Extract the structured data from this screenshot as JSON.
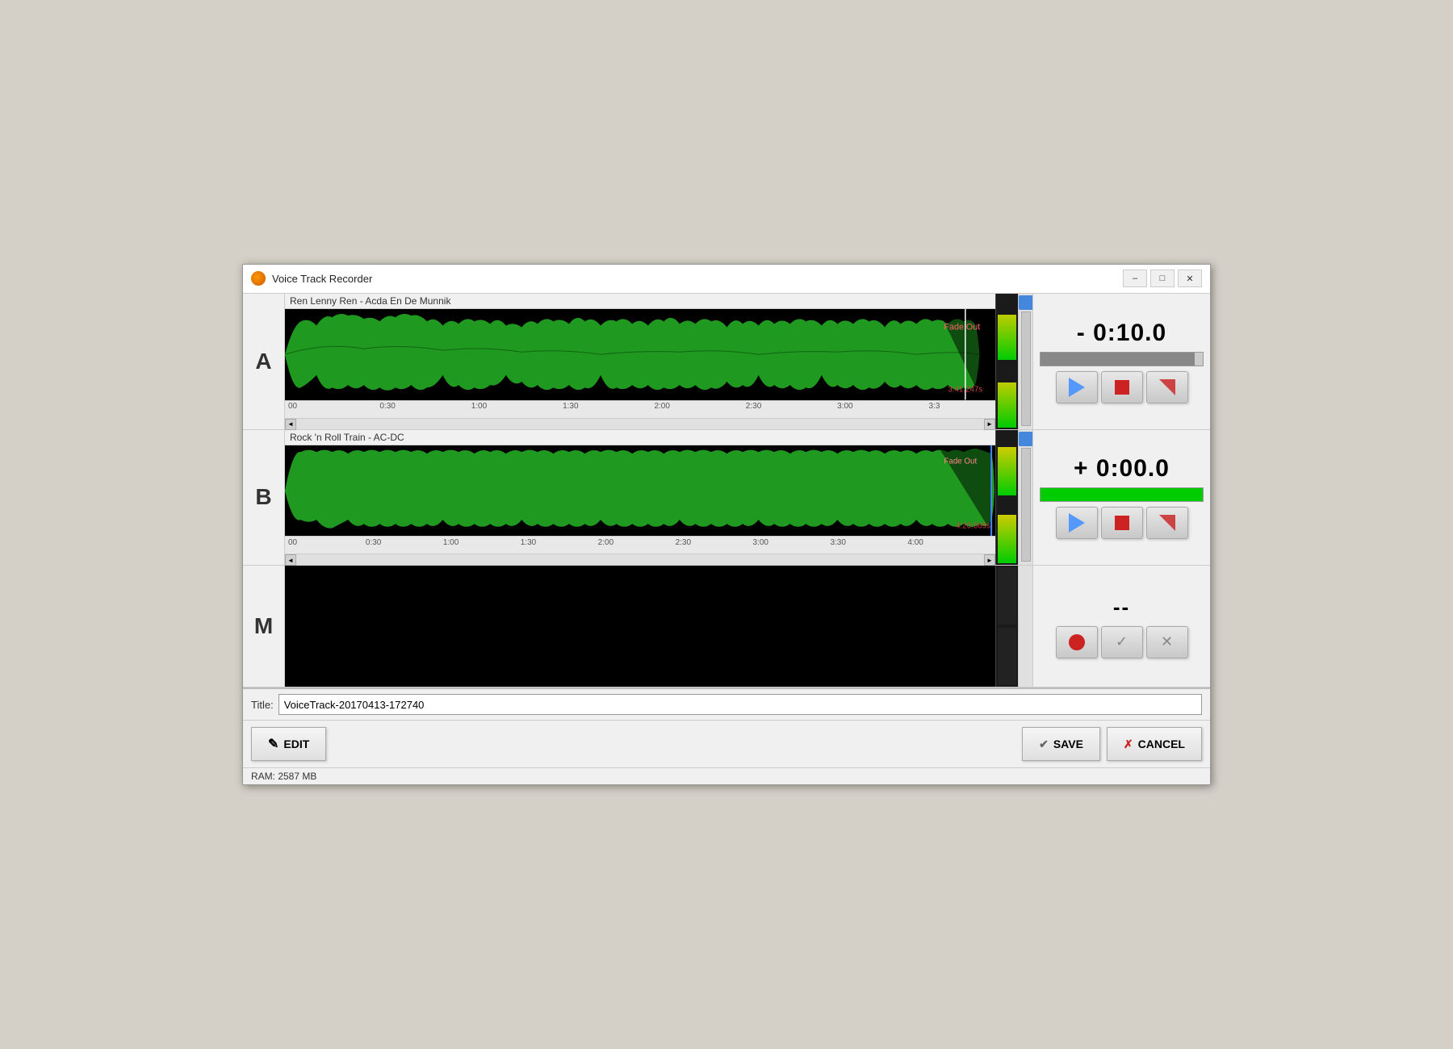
{
  "window": {
    "title": "Voice Track Recorder",
    "icon": "orange-circle"
  },
  "title_controls": {
    "minimize": "–",
    "maximize": "□",
    "close": "✕"
  },
  "tracks": [
    {
      "id": "A",
      "label": "A",
      "song_title": "Ren Lenny Ren - Acda En De Munnik",
      "time_display": "- 0:10.0",
      "progress": 95,
      "progress_type": "gray",
      "fade_label": "Fade Out",
      "duration_label": "3:41.247s",
      "timeline": [
        "00",
        "0:30",
        "1:00",
        "1:30",
        "2:00",
        "2:30",
        "3:00",
        "3:3"
      ]
    },
    {
      "id": "B",
      "label": "B",
      "song_title": "Rock 'n Roll Train - AC-DC",
      "time_display": "+ 0:00.0",
      "progress": 100,
      "progress_type": "green",
      "fade_label": "Fade Out",
      "duration_label": "4:20.069s",
      "timeline": [
        "00",
        "0:30",
        "1:00",
        "1:30",
        "2:00",
        "2:30",
        "3:00",
        "3:30",
        "4:00"
      ]
    },
    {
      "id": "M",
      "label": "M",
      "song_title": "",
      "time_display": "--",
      "progress": 0,
      "progress_type": "none",
      "timeline": []
    }
  ],
  "buttons": {
    "edit_label": "EDIT",
    "save_label": "SAVE",
    "cancel_label": "CANCEL",
    "edit_icon": "✎",
    "save_icon": "✔",
    "cancel_icon": "✗"
  },
  "title_field": {
    "label": "Title:",
    "value": "VoiceTrack-20170413-172740",
    "placeholder": "VoiceTrack-20170413-172740"
  },
  "status_bar": {
    "ram_label": "RAM: 2587 MB"
  }
}
